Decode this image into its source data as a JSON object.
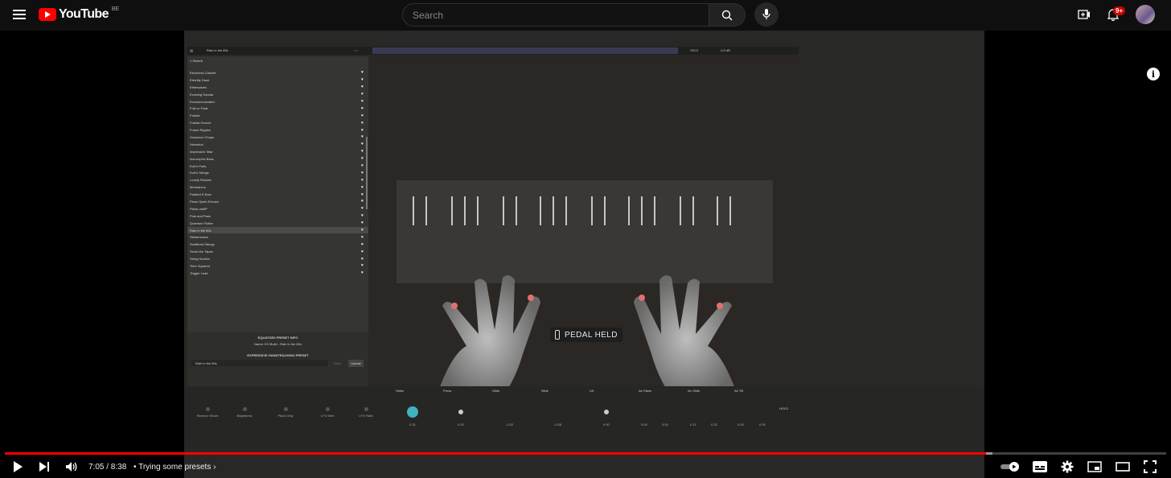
{
  "header": {
    "logo_text": "YouTube",
    "country": "BE",
    "search_placeholder": "Search",
    "notification_count": "9+"
  },
  "app": {
    "preset_title": "Rain in the 80s",
    "search_label": "Search",
    "presets": [
      {
        "label": "Electronic Clarinet"
      },
      {
        "label": "Eternity Gaze"
      },
      {
        "label": "Etherwaves"
      },
      {
        "label": "Evolving Sonata"
      },
      {
        "label": "Excommunicated"
      },
      {
        "label": "Fold or Float"
      },
      {
        "label": "Folded"
      },
      {
        "label": "Fractal Groove"
      },
      {
        "label": "Future Ripples"
      },
      {
        "label": "Granuvox Chops"
      },
      {
        "label": "Hivemind"
      },
      {
        "label": "Impressive Sitar"
      },
      {
        "label": "Isomorphic Bass"
      },
      {
        "label": "Kurt's Pads"
      },
      {
        "label": "Kurt's Strings"
      },
      {
        "label": "Lonely Rhodes"
      },
      {
        "label": "Mmmarcus"
      },
      {
        "label": "Padded E-Bow"
      },
      {
        "label": "Piano Synth Echoes"
      },
      {
        "label": "Piano-ondiP"
      },
      {
        "label": "Pots and Pans"
      },
      {
        "label": "Quantum Flutter"
      },
      {
        "label": "Rain in the 80s",
        "selected": true
      },
      {
        "label": "Skitarmonics"
      },
      {
        "label": "Scattered Strings"
      },
      {
        "label": "Scrub the Tapes"
      },
      {
        "label": "String Section"
      },
      {
        "label": "Time Squared"
      },
      {
        "label": "Trigger Lead"
      }
    ],
    "preset_info_heading": "EQUATOR2 PRESET INFO",
    "preset_info_name": "Name: EH Build - Rain in the 80s",
    "handtracking_heading": "EXPRESSIVE HANDTRACKING PRESET",
    "handtracking_value": "Rain in the 80s",
    "save_label": "Save",
    "update_label": "Update",
    "pedal_text": "PEDAL HELD",
    "tempo": "120.0",
    "volume": "-0.0 dB",
    "hold_label": "HOLD",
    "controls": [
      "Remove Strum",
      "Brightness",
      "Pluck Only",
      "LFO Wet",
      "LFO Rate"
    ],
    "params": [
      "Strike",
      "Press",
      "Glide",
      "Slide",
      "Lift",
      "Air Raise",
      "Air Glide",
      "Air Tilt"
    ],
    "values": [
      "0.32",
      "0.00",
      "-0.02",
      "-0.05",
      "0.00",
      "0.00",
      "3.00",
      "0.11",
      "0.20",
      "0.00",
      "0.00"
    ]
  },
  "player": {
    "time": "7:05 / 8:38",
    "chapter": "Trying some presets",
    "progress": 0.845
  }
}
